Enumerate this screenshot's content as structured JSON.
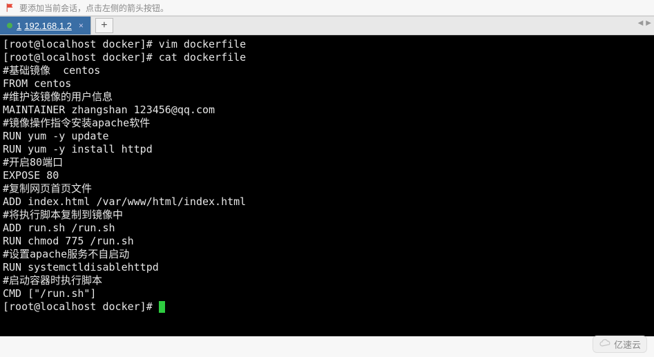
{
  "info_bar": {
    "message": "要添加当前会话，点击左侧的箭头按钮。"
  },
  "tabs": {
    "active": {
      "index": "1",
      "label": "192.168.1.2"
    },
    "close_glyph": "×",
    "add_glyph": "+"
  },
  "scroll": {
    "left": "◀",
    "right": "▶"
  },
  "terminal": {
    "lines": [
      "[root@localhost docker]# vim dockerfile",
      "[root@localhost docker]# cat dockerfile",
      "#基础镜像  centos",
      "FROM centos",
      "#维护该镜像的用户信息",
      "MAINTAINER zhangshan 123456@qq.com",
      "#镜像操作指令安装apache软件",
      "RUN yum -y update",
      "RUN yum -y install httpd",
      "#开启80端口",
      "EXPOSE 80",
      "#复制网页首页文件",
      "ADD index.html /var/www/html/index.html",
      "#将执行脚本复制到镜像中",
      "ADD run.sh /run.sh",
      "RUN chmod 775 /run.sh",
      "#设置apache服务不自启动",
      "RUN systemctldisablehttpd",
      "#启动容器时执行脚本",
      "CMD [\"/run.sh\"]"
    ],
    "prompt": "[root@localhost docker]# "
  },
  "watermark": {
    "text": "亿速云"
  }
}
